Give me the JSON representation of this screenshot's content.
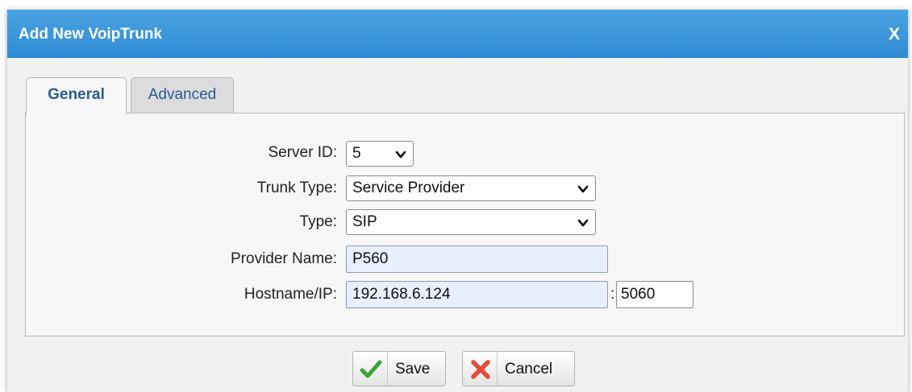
{
  "dialog": {
    "title": "Add New VoipTrunk",
    "close_label": "X"
  },
  "tabs": [
    {
      "label": "General",
      "active": true
    },
    {
      "label": "Advanced",
      "active": false
    }
  ],
  "form": {
    "server_id": {
      "label": "Server ID:",
      "value": "5"
    },
    "trunk_type": {
      "label": "Trunk Type:",
      "value": "Service Provider"
    },
    "type": {
      "label": "Type:",
      "value": "SIP"
    },
    "provider_name": {
      "label": "Provider Name:",
      "value": "P560"
    },
    "hostname": {
      "label": "Hostname/IP:",
      "value": "192.168.6.124",
      "separator": ":",
      "port": "5060"
    }
  },
  "buttons": {
    "save": {
      "label": "Save",
      "icon": "checkmark-icon"
    },
    "cancel": {
      "label": "Cancel",
      "icon": "x-icon"
    }
  },
  "colors": {
    "titlebar": "#3a96db",
    "tab_text": "#2a5a93",
    "input_bg": "#e8f0fd"
  }
}
